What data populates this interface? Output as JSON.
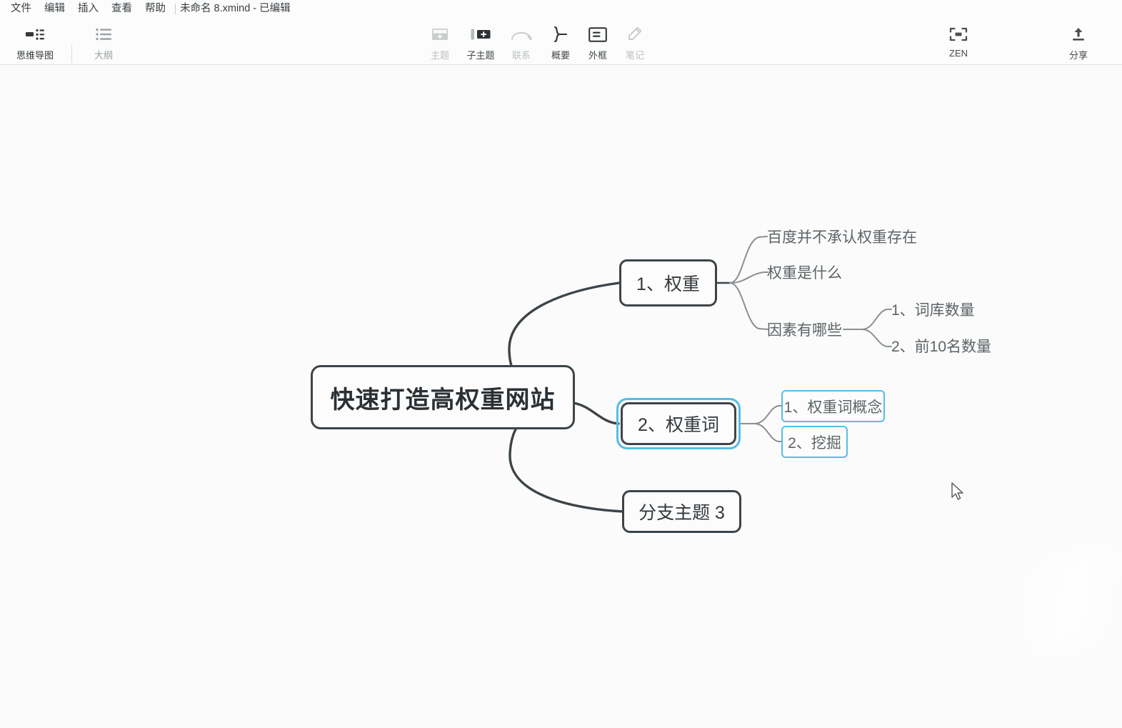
{
  "window": {
    "title": "未命名 8.xmind - 已编辑",
    "menu": [
      "文件",
      "编辑",
      "插入",
      "查看",
      "帮助"
    ]
  },
  "tabs": [
    {
      "label": "思维导图",
      "icon": "mindmap-icon",
      "active": true
    },
    {
      "label": "大纲",
      "icon": "outline-icon",
      "active": false
    }
  ],
  "toolbar": {
    "items": [
      {
        "label": "主题",
        "icon": "topic-icon",
        "enabled": false
      },
      {
        "label": "子主题",
        "icon": "subtopic-icon",
        "enabled": true
      },
      {
        "label": "联系",
        "icon": "relationship-icon",
        "enabled": false
      },
      {
        "label": "概要",
        "icon": "summary-icon",
        "enabled": true
      },
      {
        "label": "外框",
        "icon": "boundary-icon",
        "enabled": true
      },
      {
        "label": "笔记",
        "icon": "note-icon",
        "enabled": false
      }
    ],
    "right_items": [
      {
        "label": "ZEN",
        "icon": "zen-fullscreen-icon",
        "enabled": true
      },
      {
        "label": "分享",
        "icon": "share-upload-icon",
        "enabled": true
      }
    ]
  },
  "colors": {
    "accent_blue": "#2e9fe0",
    "selection_blue": "#56bde6",
    "node_border": "#3d4449",
    "canvas_bg": "#fafbfa",
    "text_dark": "#2b3034",
    "text_muted": "#5d6367"
  },
  "mindmap": {
    "root": "快速打造高权重网站",
    "branches": [
      {
        "label": "1、权重",
        "selected": false,
        "children": [
          {
            "label": "百度并不承认权重存在",
            "selected": false,
            "children": []
          },
          {
            "label": "权重是什么",
            "selected": false,
            "children": []
          },
          {
            "label": "因素有哪些",
            "selected": false,
            "children": [
              {
                "label": "1、词库数量",
                "selected": false
              },
              {
                "label": "2、前10名数量",
                "selected": false
              }
            ]
          }
        ]
      },
      {
        "label": "2、权重词",
        "selected": true,
        "children": [
          {
            "label": "1、权重词概念",
            "selected": true,
            "children": []
          },
          {
            "label": "2、挖掘",
            "selected": true,
            "children": []
          }
        ]
      },
      {
        "label": "分支主题 3",
        "selected": false,
        "children": []
      }
    ]
  }
}
